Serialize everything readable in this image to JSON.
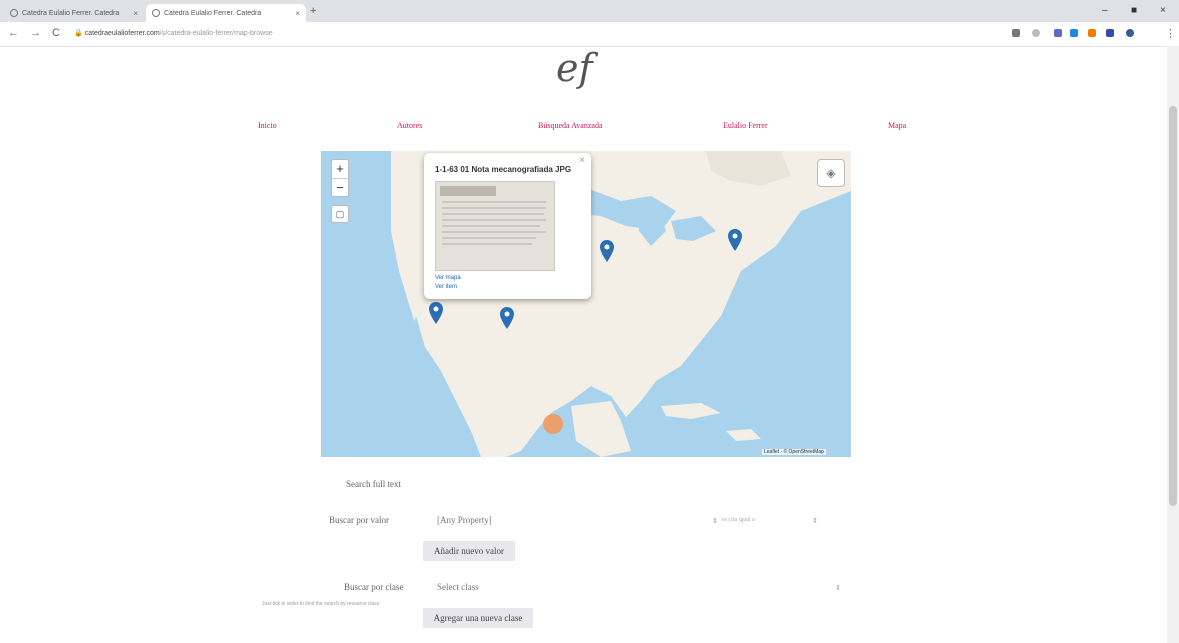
{
  "browser": {
    "tabs": [
      {
        "label": "Catedra Eulalio Ferrer. Catedra",
        "close": "×"
      },
      {
        "label": "Catedra Eulalio Ferrer. Catedra",
        "close": "×"
      }
    ],
    "new_tab": "+",
    "url_host": "catedraeulalioferrer.com",
    "url_path": "/s/catedra-eulalio-ferrer/map-browse",
    "back_icon": "←",
    "forward_icon": "→",
    "reload_icon": "C",
    "window_min": "–",
    "window_close": "×"
  },
  "site": {
    "logo": "ef",
    "nav": [
      "Inicio",
      "Autores",
      "Búsqueda Avanzada",
      "Eulalio Ferrer",
      "Mapa"
    ]
  },
  "map": {
    "zoom_in": "+",
    "zoom_out": "−",
    "popup": {
      "title": "1-1-63 01 Nota mecanografiada JPG",
      "close": "×",
      "link_map": "Ver mapa",
      "link_item": "Ver item"
    },
    "attribution": "Leaflet · © OpenStreetMap"
  },
  "form": {
    "search_full_text_label": "Search full text",
    "search_by_value_label": "Buscar por valor",
    "property_select": "[Any Property]",
    "condition_select": "es cita igual a",
    "add_value_button": "Añadir nuevo valor",
    "search_by_class_label": "Buscar por clase",
    "class_select": "Select class",
    "class_hint": "Just tick in order to limit the search by resource class",
    "add_class_button": "Agregar una nueva clase"
  }
}
